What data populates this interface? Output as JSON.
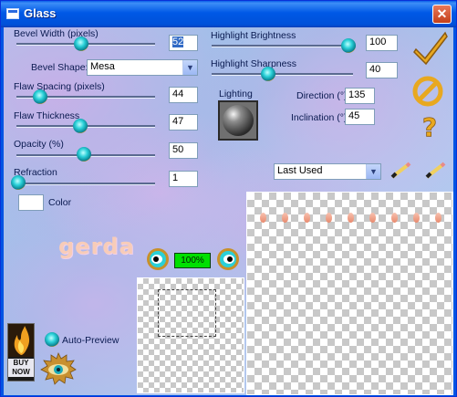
{
  "window": {
    "title": "Glass",
    "close_glyph": "✕"
  },
  "controls": {
    "bevel_width": {
      "label": "Bevel Width (pixels)",
      "value": "52",
      "level": 0.52
    },
    "bevel_shape": {
      "label": "Bevel Shape:",
      "value": "Mesa"
    },
    "flaw_spacing": {
      "label": "Flaw Spacing (pixels)",
      "value": "44",
      "level": 0.18
    },
    "flaw_thickness": {
      "label": "Flaw Thickness",
      "value": "47",
      "level": 0.47
    },
    "opacity": {
      "label": "Opacity (%)",
      "value": "50",
      "level": 0.5
    },
    "refraction": {
      "label": "Refraction",
      "value": "1",
      "level": 0.01
    },
    "color": {
      "label": "Color",
      "swatch": "#ffffff"
    },
    "highlight_brightness": {
      "label": "Highlight Brightness",
      "value": "100",
      "level": 1.0
    },
    "highlight_sharpness": {
      "label": "Highlight Sharpness",
      "value": "40",
      "level": 0.4
    },
    "lighting": {
      "label": "Lighting"
    },
    "direction": {
      "label": "Direction (°)",
      "value": "135"
    },
    "inclination": {
      "label": "Inclination (°)",
      "value": "45"
    }
  },
  "presets": {
    "value": "Last Used"
  },
  "preview": {
    "zoom": "100%",
    "auto_preview_label": "Auto-Preview"
  },
  "branding": {
    "logo": "gerda",
    "buy_now": "BUY NOW"
  },
  "icons": [
    "checkmark-icon",
    "cancel-icon",
    "help-icon",
    "save-preset-icon",
    "reset-preset-icon",
    "zoom-out-icon",
    "zoom-in-icon",
    "buy-now-icon",
    "eye-icon",
    "lighting-sphere-icon"
  ],
  "colors": {
    "title_bar": "#0058e6",
    "knob": "#2ad0d8",
    "ok_check": "#e8a820",
    "drops": "#e88a6e"
  }
}
